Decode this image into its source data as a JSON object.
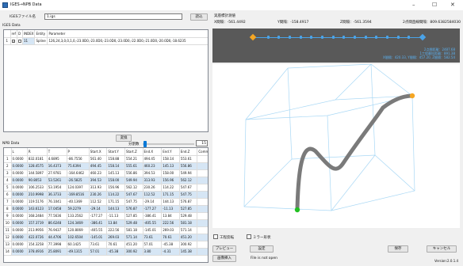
{
  "window": {
    "title": "IGES→NPB Data",
    "minimize": "–",
    "maximize": "☐",
    "close": "✕"
  },
  "iges": {
    "file_label": "IGESファイル名",
    "file_value": "1.igs",
    "read_button": "読込",
    "section_label": "IGES Data",
    "columns": [
      "",
      "ref",
      "D",
      "INDEX",
      "Entity",
      "Parameter"
    ],
    "row": {
      "num": "1",
      "index": "11",
      "entity": "Spline",
      "parameter": "126,24,3,0,0,1,0,-23.0D0,-23.0D0,-23.0D0,-23.0D0,-22.0D0,-21.0D0,-20.0D0,-18.6235"
    }
  },
  "convert_button": "変換",
  "division": {
    "label": "分割数",
    "value": "15"
  },
  "npb": {
    "label": "NPB Data",
    "columns": [
      "",
      "L",
      "R",
      "T",
      "P",
      "Start.X",
      "Start.Y",
      "Start.Z",
      "End.X",
      "End.Y",
      "End.Z",
      "Comm"
    ],
    "rows": [
      [
        "1",
        "0.0000",
        "832.0181",
        "4.6895",
        "-86.7556",
        "561.40",
        "158.88",
        "554.21",
        "494.45",
        "158.14",
        "553.61"
      ],
      [
        "2",
        "0.0000",
        "128.4575",
        "16.4373",
        "75.6394",
        "494.45",
        "158.14",
        "555.61",
        "460.23",
        "145.13",
        "556.86"
      ],
      [
        "3",
        "0.0000",
        "144.5897",
        "27.9781",
        "-164.6462",
        "460.23",
        "145.13",
        "556.86",
        "394.53",
        "158.00",
        "549.94"
      ],
      [
        "4",
        "0.0000",
        "90.8053",
        "53.5261",
        "-26.5825",
        "394.53",
        "158.00",
        "549.94",
        "313.93",
        "156.96",
        "562.12"
      ],
      [
        "5",
        "0.0000",
        "106.2533",
        "53.1954",
        "124.0397",
        "313.93",
        "156.96",
        "562.12",
        "230.26",
        "114.22",
        "547.67"
      ],
      [
        "6",
        "0.0000",
        "210.9998",
        "36.3733",
        "-169.8516",
        "230.26",
        "114.22",
        "547.67",
        "112.52",
        "171.15",
        "547.75"
      ],
      [
        "7",
        "0.0000",
        "119.5176",
        "76.1041",
        "-40.1369",
        "112.52",
        "171.15",
        "547.75",
        "-29.14",
        "144.13",
        "576.87"
      ],
      [
        "8",
        "0.0000",
        "143.6123",
        "17.0458",
        "59.2279",
        "-29.14",
        "144.13",
        "576.87",
        "-177.27",
        "-11.13",
        "527.85"
      ],
      [
        "9",
        "0.0000",
        "168.2484",
        "77.5636",
        "133.2562",
        "-177.27",
        "-11.13",
        "527.85",
        "-386.41",
        "13.84",
        "529.48"
      ],
      [
        "10",
        "0.0000",
        "157.3719",
        "86.6248",
        "124.3469",
        "-386.41",
        "13.84",
        "529.48",
        "-405.55",
        "222.56",
        "581.18"
      ],
      [
        "11",
        "0.0000",
        "213.9956",
        "76.9437",
        "120.8069",
        "-405.55",
        "222.56",
        "581.18",
        "-145.01",
        "269.03",
        "571.14"
      ],
      [
        "12",
        "0.0000",
        "422.0726",
        "44.4706",
        "102.6504",
        "-145.01",
        "269.03",
        "571.14",
        "73.61",
        "70.61",
        "451.20"
      ],
      [
        "13",
        "0.0000",
        "154.3258",
        "77.3998",
        "60.1425",
        "73.61",
        "70.61",
        "451.20",
        "57.01",
        "-45.38",
        "300.92"
      ],
      [
        "14",
        "0.0000",
        "378.4916",
        "25.8091",
        "-49.1315",
        "57.01",
        "-45.38",
        "300.92",
        "3.80",
        "-4.31",
        "145.38"
      ]
    ]
  },
  "status": {
    "header": "実座標計測値",
    "x_label": "X間隔：-561.4492",
    "y_label": "Y間隔：-158.4917",
    "z_label": "Z間隔：-561.3594",
    "total_label": "2点間直線間隔：809.6382584030"
  },
  "info": {
    "line1": "2点間距離：2487.68",
    "line2": "1工程最短距離：891.38",
    "line3": "X間隔：420.33, Y間隔：457.20, Z間隔：582.54"
  },
  "options": {
    "process_label": "工程反転",
    "mirror_label": "ミラー形状"
  },
  "buttons": {
    "preview": "プレビュー",
    "settings": "設定",
    "save": "保存",
    "cancel": "キャンセル",
    "image_insert": "画像挿入"
  },
  "file_status": "File is not open",
  "version": "Version:2.0.1.4",
  "colors": {
    "panel": "#595959",
    "timeline": "#4aa3e8",
    "start": "#f5a623",
    "end": "#22c022",
    "path": "#7a7a7a",
    "box": "#a9d8f5"
  }
}
